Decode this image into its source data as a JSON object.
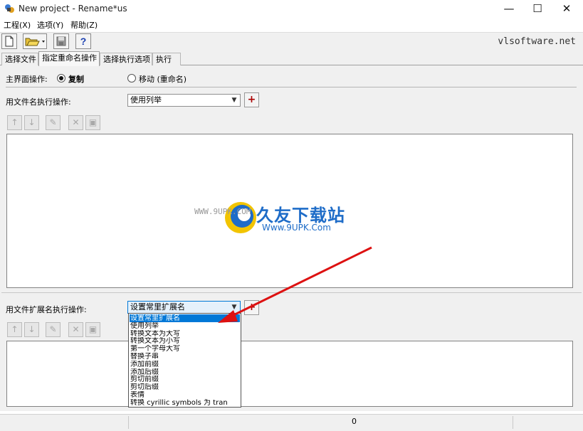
{
  "window": {
    "title": "New project - Rename*us",
    "minimize": "—",
    "maximize": "☐",
    "close": "✕"
  },
  "menu": [
    "工程(X)",
    "选项(Y)",
    "帮助(Z)"
  ],
  "toolbar": {
    "brand": "vlsoftware.net"
  },
  "tabs": [
    "选择文件",
    "指定重命名操作",
    "选择执行选项",
    "执行"
  ],
  "main": {
    "main_op_label": "主界面操作:",
    "radio_copy": "复制",
    "radio_move": "移动 (重命名)",
    "filename_label": "用文件名执行操作:",
    "filename_combo": "使用列举",
    "ext_label": "用文件扩展名执行操作:",
    "ext_combo": "设置常里扩展名",
    "plus": "+"
  },
  "dropdown": {
    "items": [
      "设置常里扩展名",
      "使用列举",
      "转换文本为大写",
      "转换文本为小写",
      "第一个字母大写",
      "替换子串",
      "添加前缀",
      "添加后缀",
      "剪切前缀",
      "剪切后缀",
      "表情",
      "转换 cyrillic symbols 为 tran"
    ],
    "selected_index": 0
  },
  "status": {
    "count": "0"
  },
  "watermark": {
    "url_left": "WWW.9UPK.COM",
    "title": "久友下载站",
    "url": "Www.9UPK.Com"
  }
}
